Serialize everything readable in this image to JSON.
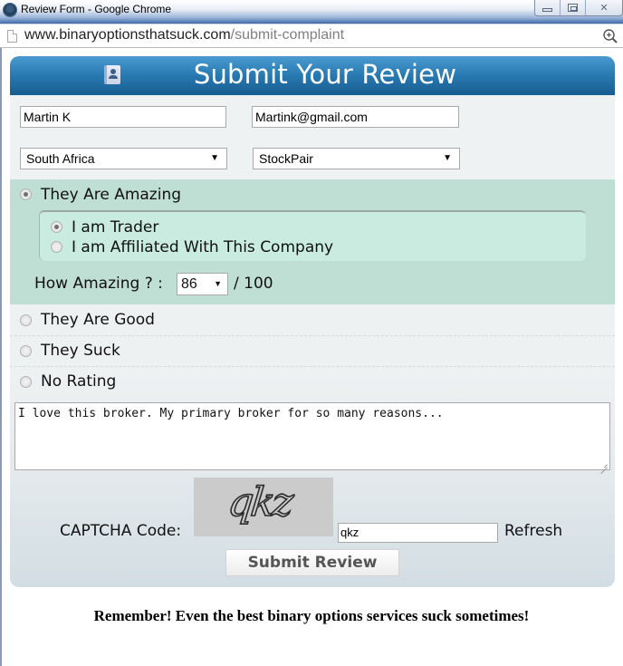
{
  "window": {
    "title": "Review Form - Google Chrome",
    "controls": [
      "minimize",
      "maximize",
      "close"
    ]
  },
  "address_bar": {
    "host": "www.binaryoptionsthatsuck.com",
    "path": "/submit-complaint",
    "zoom_icon": "zoom-in-icon"
  },
  "form": {
    "heading": "Submit Your Review",
    "header_icon": "address-book-icon",
    "name_value": "Martin K",
    "email_value": "Martink@gmail.com",
    "country_selected": "South Africa",
    "broker_selected": "StockPair",
    "ratings": [
      {
        "label": "They Are Amazing",
        "checked": true
      },
      {
        "label": "They Are Good",
        "checked": false
      },
      {
        "label": "They Suck",
        "checked": false
      },
      {
        "label": "No Rating",
        "checked": false
      }
    ],
    "reviewer_types": [
      {
        "label": "I am Trader",
        "checked": true
      },
      {
        "label": "I am Affiliated With This Company",
        "checked": false
      }
    ],
    "how_amazing": {
      "prefix": "How Amazing ? :",
      "selected": "86",
      "suffix": "/ 100"
    },
    "comment_value": "I love this broker. My primary broker for so many reasons...",
    "captcha": {
      "label": "CAPTCHA Code:",
      "image_text": "qkz",
      "input_value": "qkz",
      "refresh_label": "Refresh"
    },
    "submit_label": "Submit Review"
  },
  "footer_note": "Remember! Even the best binary options services suck sometimes!",
  "colors": {
    "header_blue": "#2879b1",
    "amazing_bg": "#bfdfd5",
    "sub_box_bg": "#c9ebe0",
    "panel_bg": "#eff2f3"
  }
}
